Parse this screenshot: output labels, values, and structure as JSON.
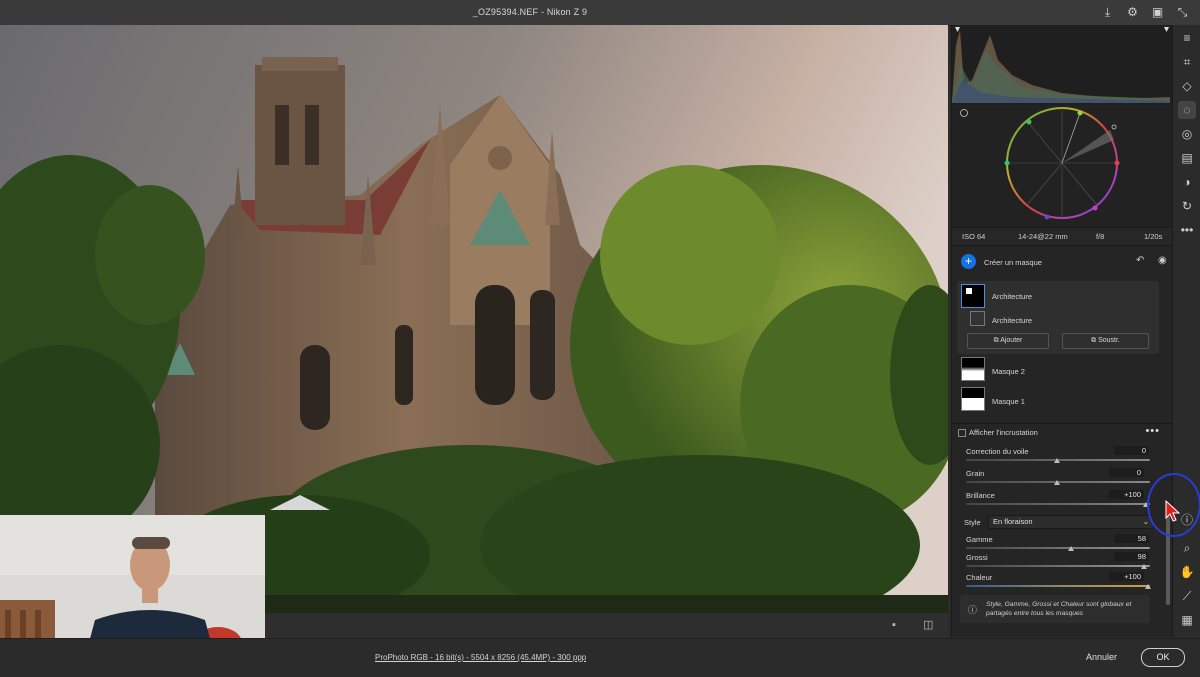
{
  "window": {
    "title": "_OZ95394.NEF  -  Nikon Z 9"
  },
  "top_icons": [
    "save-icon",
    "gear-icon",
    "slideshow-icon",
    "collapse-icon"
  ],
  "exif": {
    "iso": "ISO 64",
    "lens": "14-24@22 mm",
    "aperture": "f/8",
    "shutter": "1/20s"
  },
  "masks": {
    "create_label": "Créer un masque",
    "group": {
      "name": "Architecture",
      "component": "Architecture",
      "add_label": "Ajouter",
      "subtract_label": "Soustr."
    },
    "items": [
      {
        "name": "Masque 2"
      },
      {
        "name": "Masque 1"
      }
    ],
    "overlay_label": "Afficher l'incrustation"
  },
  "adjustments": {
    "haze": {
      "label": "Correction du voile",
      "value": "0"
    },
    "grain": {
      "label": "Grain",
      "value": "0"
    },
    "brillance": {
      "label": "Brillance",
      "value": "+100"
    },
    "style": {
      "label": "Style",
      "value": "En floraison"
    },
    "gamme": {
      "label": "Gamme",
      "value": "58"
    },
    "grossi": {
      "label": "Grossi",
      "value": "98"
    },
    "chaleur": {
      "label": "Chaleur",
      "value": "+100"
    },
    "info": "Style, Gamme, Grossi et Chaleur sont globaux et partagés entre tous les masques"
  },
  "status": {
    "file_info": "ProPhoto RGB - 16 bit(s) - 5504 x 8256 (45.4MP) - 300 ppp",
    "cancel_label": "Annuler",
    "ok_label": "OK"
  },
  "colors": {
    "accent": "#1473e6",
    "highlight": "#2a3bd8",
    "cursor": "#e02020"
  }
}
